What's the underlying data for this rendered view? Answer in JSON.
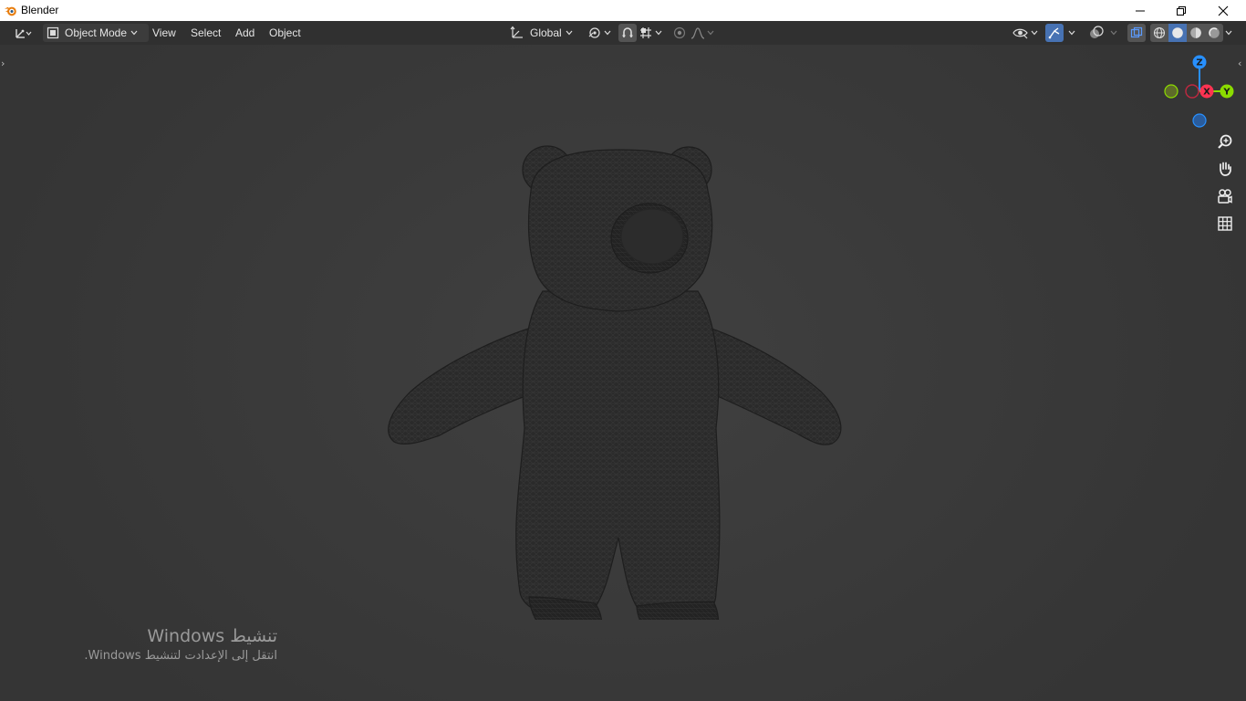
{
  "window": {
    "title": "Blender"
  },
  "header": {
    "mode": "Object Mode",
    "menus": [
      "View",
      "Select",
      "Add",
      "Object"
    ],
    "transform_orientation": "Global"
  },
  "gizmo": {
    "z": "Z",
    "x": "X",
    "y": "Y"
  },
  "activation": {
    "title": "تنشيط Windows",
    "message": "انتقل إلى الإعدادت لتنشيط Windows."
  },
  "colors": {
    "accent": "#4772b3",
    "axis_x": "#ff3352",
    "axis_y": "#8bdc00",
    "axis_z": "#2890ff",
    "viewport_bg": "#393939",
    "header_bg": "#303030"
  },
  "icons": [
    "blender-logo-icon",
    "minimize-icon",
    "restore-icon",
    "close-icon",
    "editor-type-icon",
    "object-mode-icon",
    "transform-orientation-icon",
    "pivot-point-icon",
    "snap-icon",
    "snap-increment-icon",
    "proportional-editing-icon",
    "falloff-icon",
    "visibility-icon",
    "gizmo-icon",
    "overlay-icon",
    "xray-icon",
    "wireframe-shading-icon",
    "solid-shading-icon",
    "material-shading-icon",
    "rendered-shading-icon",
    "zoom-icon",
    "pan-hand-icon",
    "camera-view-icon",
    "perspective-grid-icon"
  ]
}
